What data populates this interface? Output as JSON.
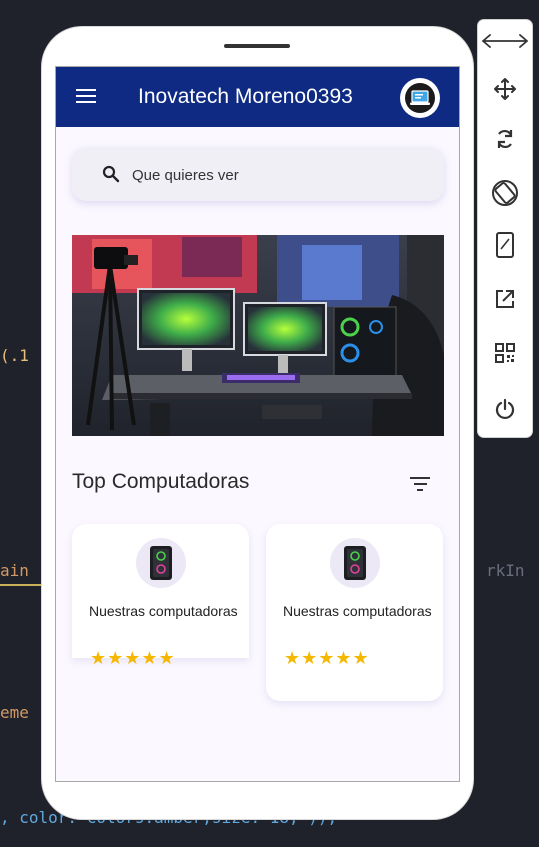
{
  "code": {
    "line1": "(.1",
    "line2": "ain",
    "line3": "rkIn",
    "line4": "eme",
    "line5": ", color: Colors.amber,size: 18, )),"
  },
  "app": {
    "title": "Inovatech Moreno0393",
    "search_placeholder": "Que quieres ver",
    "section_title": "Top Computadoras",
    "cards": [
      {
        "title": "Nuestras computadoras",
        "stars": "★★★★★",
        "rating": 5
      },
      {
        "title": "Nuestras computadoras",
        "stars": "★★★★★",
        "rating": 5
      }
    ]
  },
  "colors": {
    "appbar": "#0e2a83",
    "star": "#f5b800",
    "editor_bg": "#20222b"
  },
  "toolbar": {
    "items": [
      "resize-icon",
      "move-icon",
      "rotate-icon",
      "orientation-icon",
      "device-frame-icon",
      "open-external-icon",
      "qr-code-icon",
      "power-icon"
    ]
  }
}
